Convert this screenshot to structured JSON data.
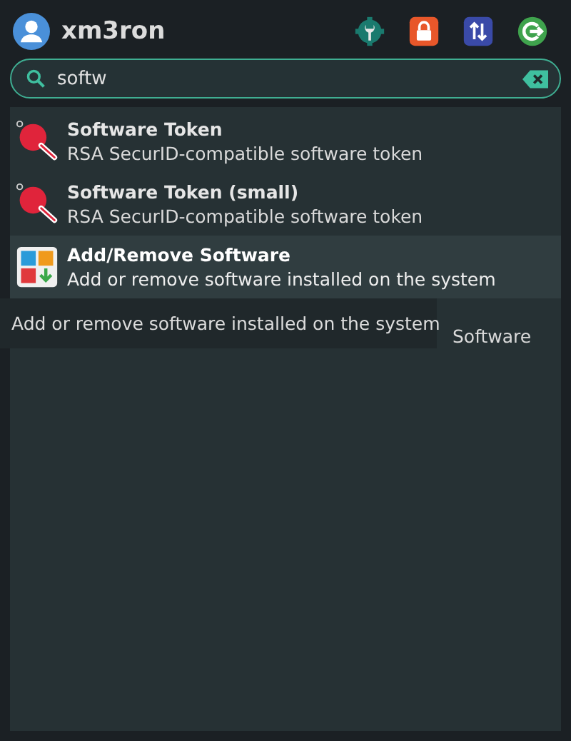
{
  "user": {
    "name": "xm3ron"
  },
  "search": {
    "value": "softw"
  },
  "results": [
    {
      "kind": "token",
      "title": "Software Token",
      "description": "RSA SecurID-compatible software token",
      "selected": false
    },
    {
      "kind": "token",
      "title": "Software Token (small)",
      "description": "RSA SecurID-compatible software token",
      "selected": false
    },
    {
      "kind": "software",
      "title": "Add/Remove Software",
      "description": "Add or remove software installed on the system",
      "selected": true
    },
    {
      "kind": "hidden",
      "description": "Software"
    }
  ],
  "tooltip": "Add or remove software installed on the system"
}
